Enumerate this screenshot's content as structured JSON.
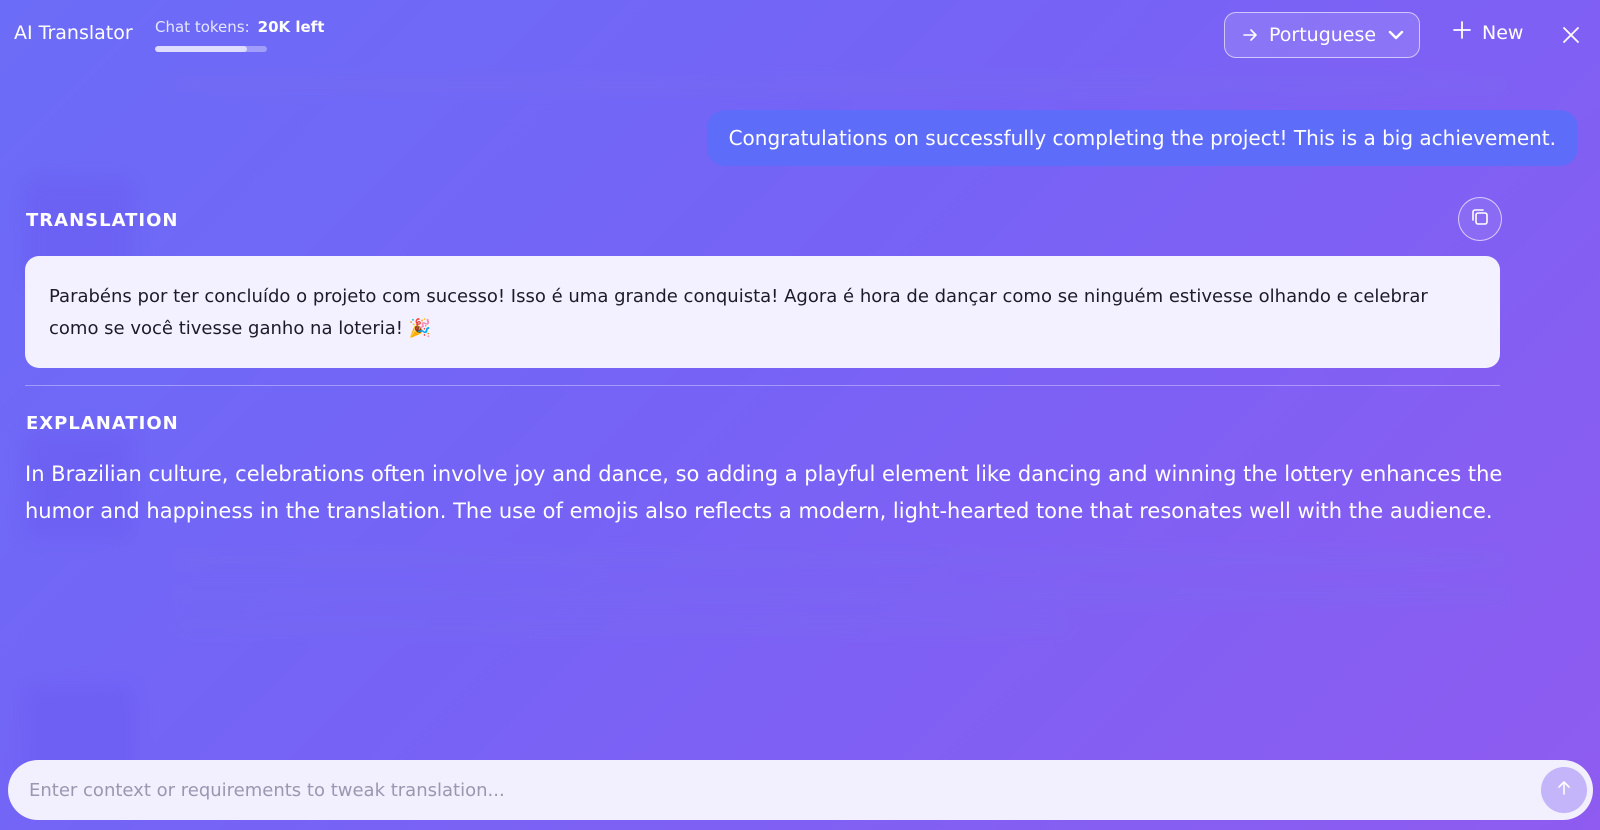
{
  "header": {
    "app_title": "AI Translator",
    "tokens_label": "Chat tokens:",
    "tokens_value": "20K left",
    "tokens_fraction": 0.82,
    "target_language": "Portuguese",
    "new_label": "New"
  },
  "conversation": {
    "user_message": "Congratulations on successfully completing the project! This is a big achievement.",
    "translation_heading": "TRANSLATION",
    "translation_text": "Parabéns por ter concluído o projeto com sucesso! Isso é uma grande conquista! Agora é hora de dançar como se ninguém estivesse olhando e celebrar como se você tivesse ganho na loteria! 🎉",
    "explanation_heading": "EXPLANATION",
    "explanation_text": "In Brazilian culture, celebrations often involve joy and dance, so adding a playful element like dancing and winning the lottery enhances the humor and happiness in the translation. The use of emojis also reflects a modern, light-hearted tone that resonates well with the audience."
  },
  "input": {
    "placeholder": "Enter context or requirements to tweak translation...",
    "value": ""
  },
  "colors": {
    "background_start": "#6b6cf7",
    "background_end": "#8f5bf0",
    "user_bubble": "#5d6cf9",
    "card": "#f3f0ff",
    "send_button": "#c4b4fa"
  },
  "icons": {
    "language_arrow": "arrow-right-icon",
    "language_dropdown": "chevron-down-icon",
    "new": "plus-icon",
    "close": "close-icon",
    "copy": "copy-icon",
    "send": "arrow-up-icon"
  }
}
